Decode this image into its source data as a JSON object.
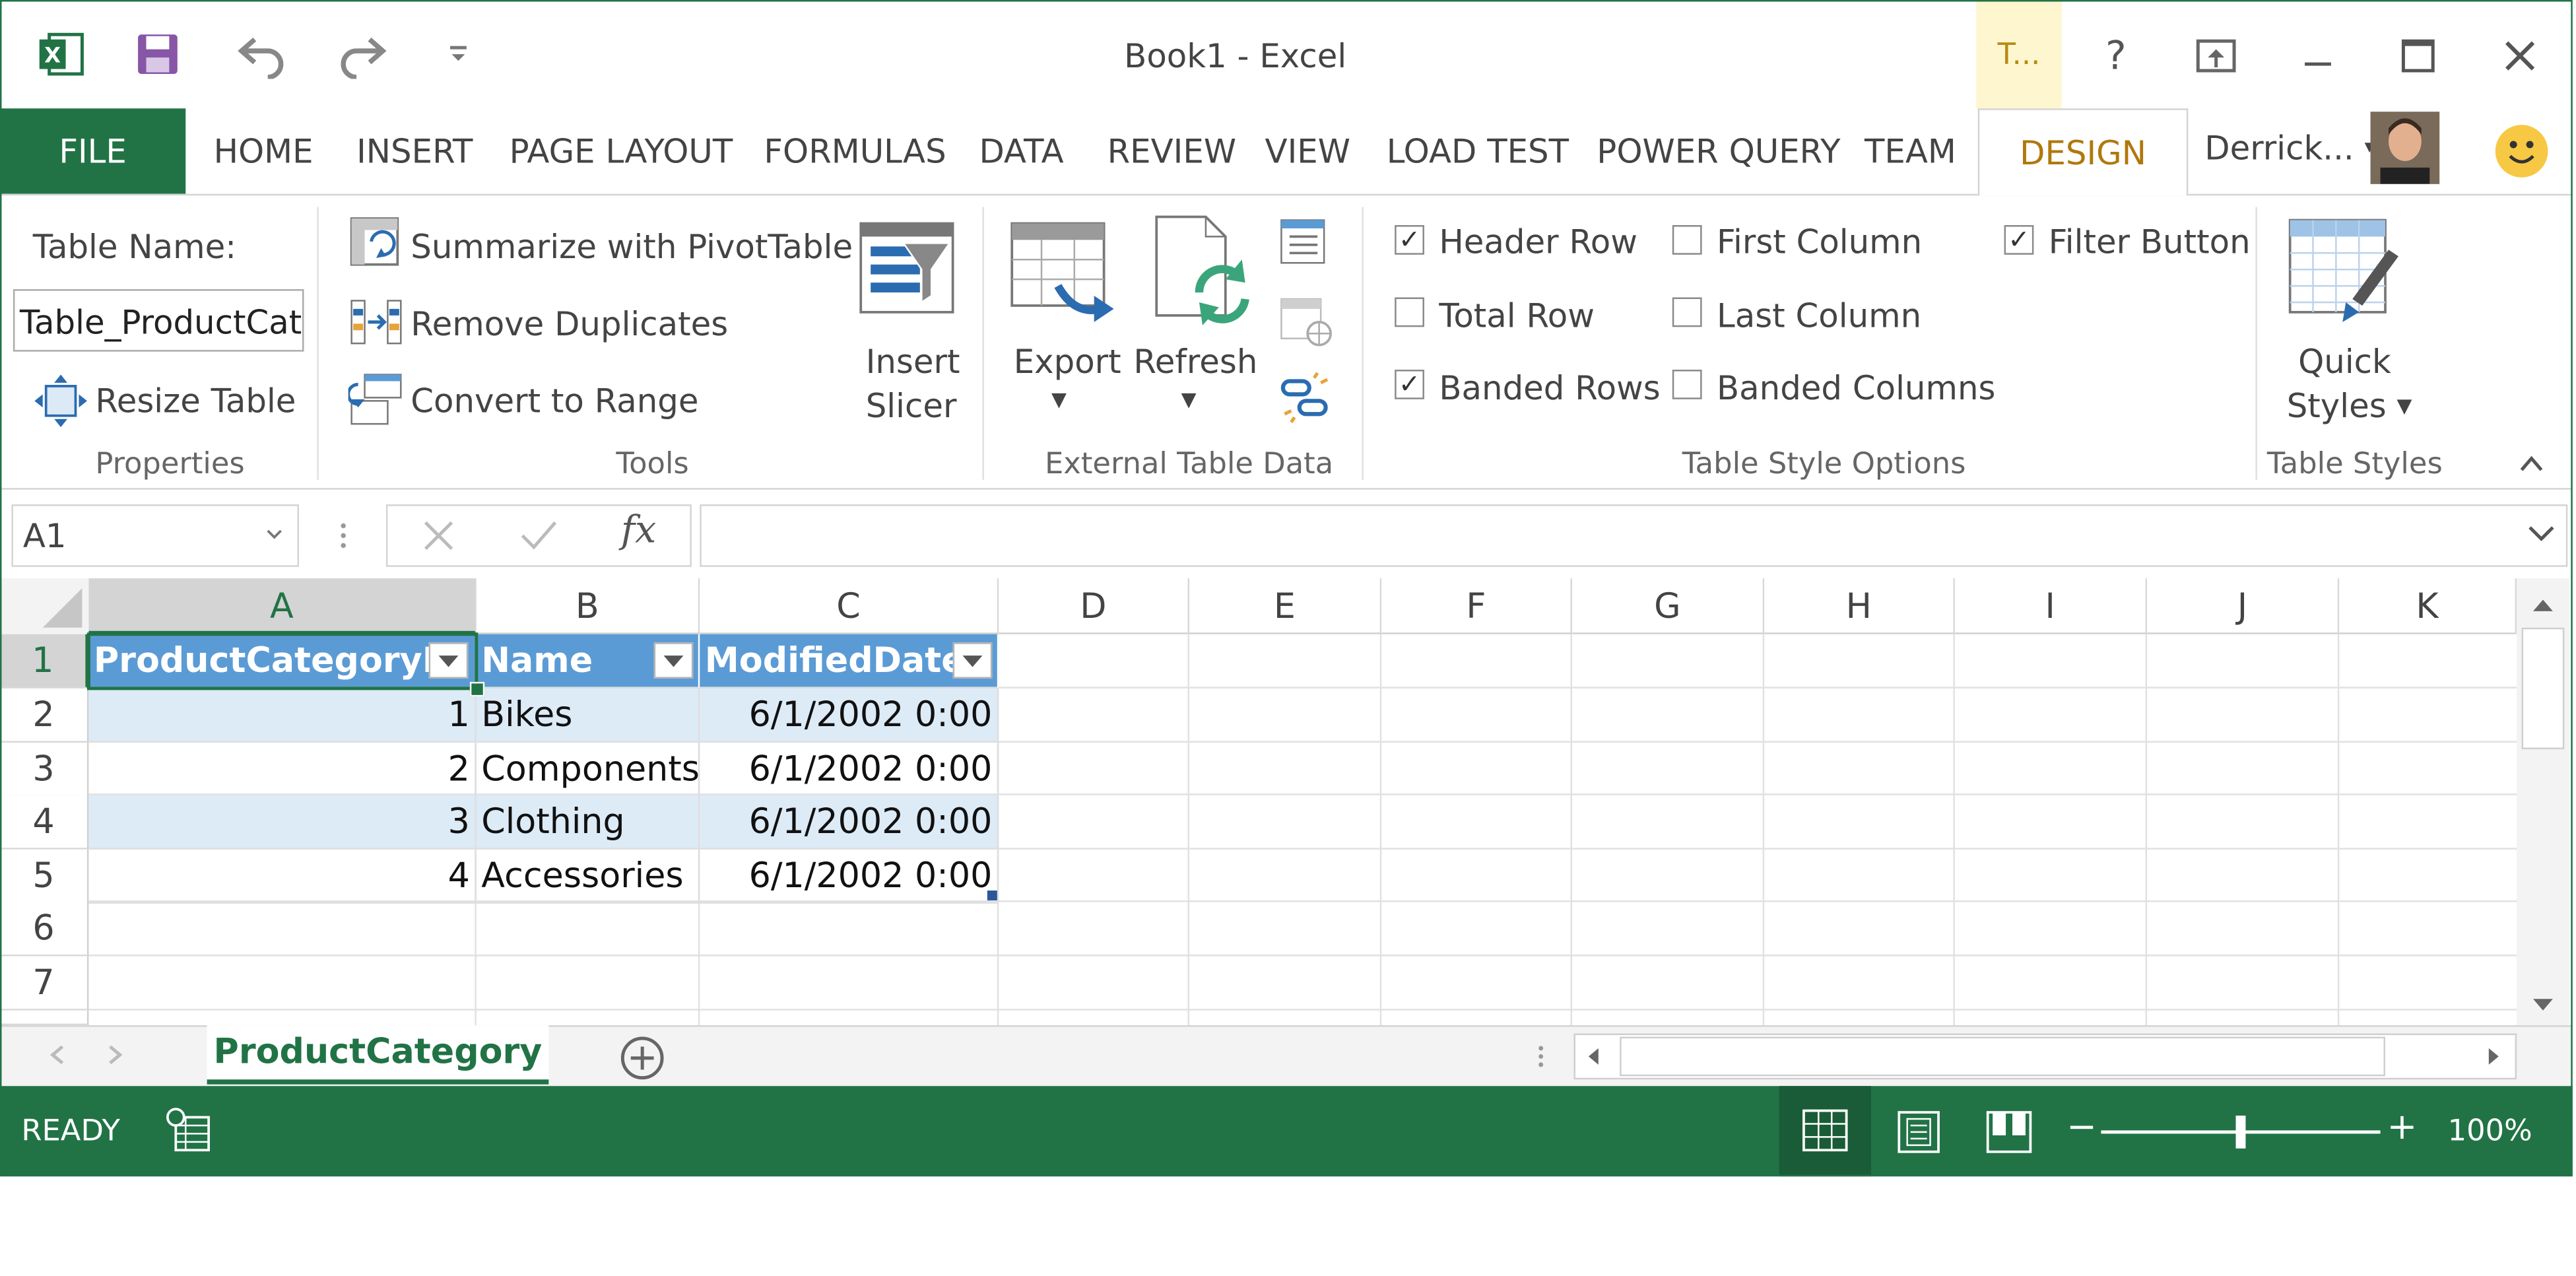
{
  "app": {
    "title": "Book1 - Excel",
    "contextual_tab": "T...",
    "help": "?",
    "user_name": "Derrick...",
    "accent": "#217346"
  },
  "tabs": {
    "file": "FILE",
    "items": [
      "HOME",
      "INSERT",
      "PAGE LAYOUT",
      "FORMULAS",
      "DATA",
      "REVIEW",
      "VIEW",
      "LOAD TEST",
      "POWER QUERY",
      "TEAM"
    ],
    "design": "DESIGN"
  },
  "ribbon": {
    "properties": {
      "table_name_label": "Table Name:",
      "table_name_value": "Table_ProductCategory",
      "resize": "Resize Table",
      "group": "Properties"
    },
    "tools": {
      "pivot": "Summarize with PivotTable",
      "duplicates": "Remove Duplicates",
      "convert": "Convert to Range",
      "slicer_1": "Insert",
      "slicer_2": "Slicer",
      "group": "Tools"
    },
    "external": {
      "export": "Export",
      "refresh": "Refresh",
      "group": "External Table Data"
    },
    "style_options": {
      "header_row": "Header Row",
      "total_row": "Total Row",
      "banded_rows": "Banded Rows",
      "first_column": "First Column",
      "last_column": "Last Column",
      "banded_columns": "Banded Columns",
      "filter_button": "Filter Button",
      "group": "Table Style Options",
      "checked": {
        "header_row": true,
        "total_row": false,
        "banded_rows": true,
        "first_column": false,
        "last_column": false,
        "banded_columns": false,
        "filter_button": true
      }
    },
    "styles": {
      "quick_1": "Quick",
      "quick_2": "Styles",
      "group": "Table Styles"
    }
  },
  "formula_bar": {
    "name_box": "A1",
    "fx": "fx",
    "content": ""
  },
  "grid": {
    "columns": [
      "A",
      "B",
      "C",
      "D",
      "E",
      "F",
      "G",
      "H",
      "I",
      "J",
      "K"
    ],
    "rows": [
      "1",
      "2",
      "3",
      "4",
      "5",
      "6",
      "7"
    ],
    "selected_cell": "A1",
    "table": {
      "headers": [
        "ProductCategoryID",
        "Name",
        "ModifiedDate"
      ],
      "rows": [
        [
          "1",
          "Bikes",
          "6/1/2002 0:00"
        ],
        [
          "2",
          "Components",
          "6/1/2002 0:00"
        ],
        [
          "3",
          "Clothing",
          "6/1/2002 0:00"
        ],
        [
          "4",
          "Accessories",
          "6/1/2002 0:00"
        ]
      ],
      "header_color": "#5b9bd5",
      "band_color": "#ddebf7"
    }
  },
  "sheets": {
    "active": "ProductCategory"
  },
  "status": {
    "ready": "READY",
    "zoom": "100%",
    "zoom_level": 0.5
  }
}
